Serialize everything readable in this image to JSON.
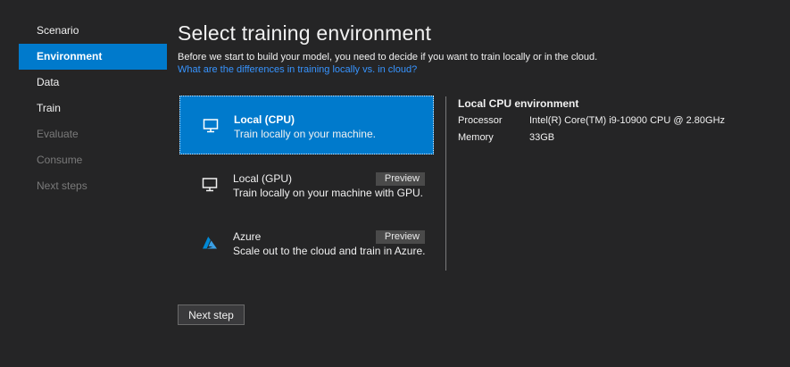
{
  "sidebar": {
    "items": [
      {
        "label": "Scenario",
        "state": "enabled"
      },
      {
        "label": "Environment",
        "state": "active"
      },
      {
        "label": "Data",
        "state": "enabled"
      },
      {
        "label": "Train",
        "state": "enabled"
      },
      {
        "label": "Evaluate",
        "state": "disabled"
      },
      {
        "label": "Consume",
        "state": "disabled"
      },
      {
        "label": "Next steps",
        "state": "disabled"
      }
    ]
  },
  "main": {
    "title": "Select training environment",
    "intro": "Before we start to build your model, you need to decide if you want to train locally or in the cloud.",
    "link": "What are the differences in training locally vs. in cloud?",
    "options": [
      {
        "name": "Local (CPU)",
        "description": "Train locally on your machine.",
        "icon": "monitor-icon",
        "selected": true
      },
      {
        "name": "Local (GPU)",
        "description": "Train locally on your machine with GPU.",
        "badge": "Preview",
        "icon": "monitor-icon"
      },
      {
        "name": "Azure",
        "description": "Scale out to the cloud and train in Azure.",
        "badge": "Preview",
        "icon": "azure-icon"
      }
    ],
    "details": {
      "title": "Local CPU environment",
      "rows": [
        {
          "key": "Processor",
          "value": "Intel(R) Core(TM) i9-10900 CPU @ 2.80GHz"
        },
        {
          "key": "Memory",
          "value": "33GB"
        }
      ]
    },
    "next_button": "Next step"
  },
  "colors": {
    "background": "#252526",
    "accent": "#007acc",
    "link": "#3794ff",
    "disabled_text": "#7a7a7a",
    "badge_bg": "#4a4a4a"
  }
}
